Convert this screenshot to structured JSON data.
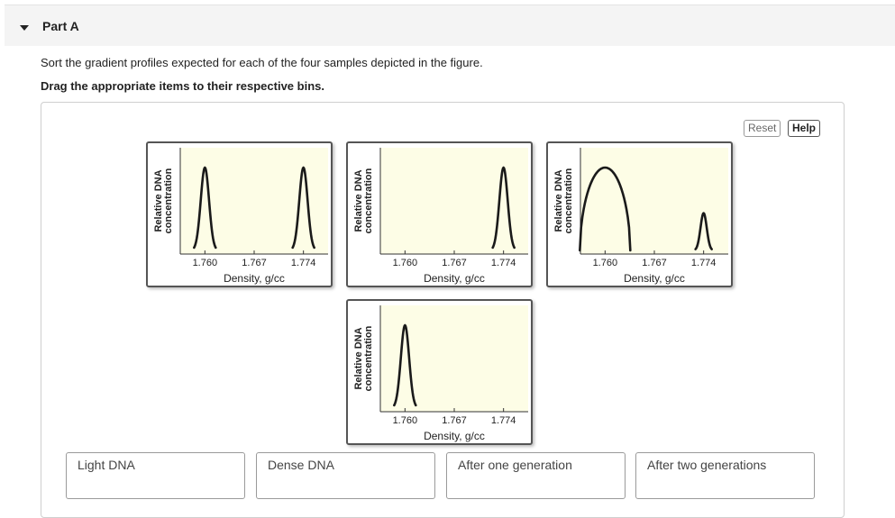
{
  "part": {
    "title": "Part A"
  },
  "instructions": "Sort the gradient profiles expected for each of the four samples depicted in the figure.",
  "drag_note": "Drag the appropriate items to their respective bins.",
  "buttons": {
    "reset": "Reset",
    "help": "Help"
  },
  "plot_text": {
    "ylabel_line1": "Relative DNA",
    "ylabel_line2": "concentration",
    "xlabel": "Density, g/cc",
    "ticks": [
      "1.760",
      "1.767",
      "1.774"
    ]
  },
  "chart_data": [
    {
      "type": "line",
      "x": [
        1.76,
        1.774
      ],
      "y": [
        1.0,
        1.0
      ],
      "xlabel": "Density, g/cc",
      "ylabel": "Relative DNA concentration",
      "xticks": [
        "1.760",
        "1.767",
        "1.774"
      ]
    },
    {
      "type": "line",
      "x": [
        1.774
      ],
      "y": [
        1.0
      ],
      "xlabel": "Density, g/cc",
      "ylabel": "Relative DNA concentration",
      "xticks": [
        "1.760",
        "1.767",
        "1.774"
      ]
    },
    {
      "type": "line",
      "x": [
        1.76,
        1.774
      ],
      "y": [
        1.0,
        0.45
      ],
      "xlabel": "Density, g/cc",
      "ylabel": "Relative DNA concentration",
      "xticks": [
        "1.760",
        "1.767",
        "1.774"
      ]
    },
    {
      "type": "line",
      "x": [
        1.76
      ],
      "y": [
        1.0
      ],
      "xlabel": "Density, g/cc",
      "ylabel": "Relative DNA concentration",
      "xticks": [
        "1.760",
        "1.767",
        "1.774"
      ]
    }
  ],
  "bins": [
    "Light DNA",
    "Dense DNA",
    "After one generation",
    "After two generations"
  ],
  "colors": {
    "plot_bg": "#fdfde6",
    "curve": "#1a1a1a",
    "card_border": "#555555",
    "header_bg": "#f4f4f4"
  }
}
